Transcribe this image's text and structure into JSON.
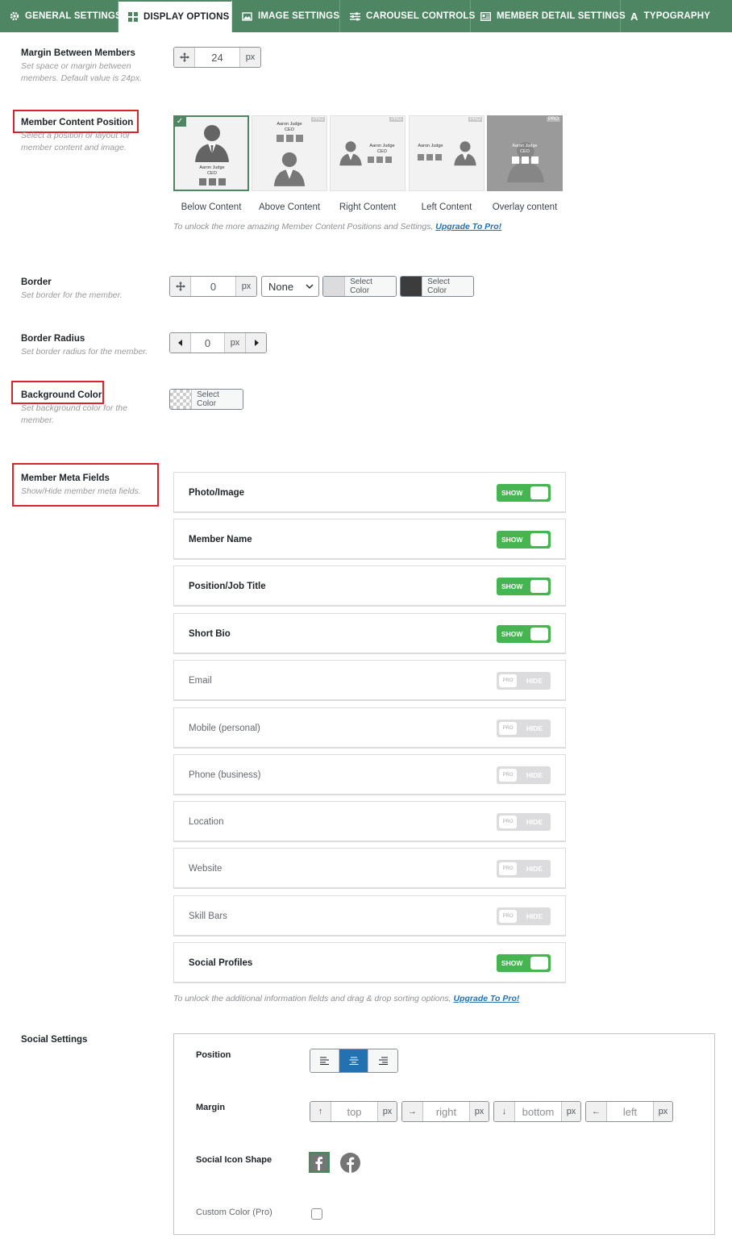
{
  "tabs": [
    {
      "label": "GENERAL SETTINGS",
      "icon": "gear-icon"
    },
    {
      "label": "DISPLAY OPTIONS",
      "icon": "grid-icon",
      "active": true
    },
    {
      "label": "IMAGE SETTINGS",
      "icon": "image-icon"
    },
    {
      "label": "CAROUSEL CONTROLS",
      "icon": "sliders-icon"
    },
    {
      "label": "MEMBER DETAIL SETTINGS",
      "icon": "id-card-icon"
    },
    {
      "label": "TYPOGRAPHY",
      "icon": "font-icon"
    }
  ],
  "margin": {
    "title": "Margin Between Members",
    "desc": "Set space or margin between members. Default value is 24px.",
    "value": "24",
    "unit": "px"
  },
  "content_position": {
    "title": "Member Content Position",
    "desc": "Select a position or layout for member content and image.",
    "sample_name": "Aaron Judge",
    "sample_role": "CEO",
    "pro_badge": "PRO",
    "options": [
      "Below Content",
      "Above Content",
      "Right Content",
      "Left Content",
      "Overlay content"
    ],
    "note": "To unlock the more amazing Member Content Positions and Settings, ",
    "note_link": "Upgrade To Pro!"
  },
  "border": {
    "title": "Border",
    "desc": "Set border for the member.",
    "value": "0",
    "unit": "px",
    "style": "None",
    "color_label": "Select Color",
    "hover_color_label": "Select Color",
    "swatch1": "#dcdcde",
    "swatch2": "#3c3c3c"
  },
  "border_radius": {
    "title": "Border Radius",
    "desc": "Set border radius for the member.",
    "value": "0",
    "unit": "px"
  },
  "background": {
    "title": "Background Color",
    "desc": "Set background color for the member.",
    "color_label": "Select Color"
  },
  "meta_fields": {
    "title": "Member Meta Fields",
    "desc": "Show/Hide member meta fields.",
    "show_label": "SHOW",
    "hide_label": "HIDE",
    "pro_label": "PRO",
    "items": [
      {
        "label": "Photo/Image",
        "on": true
      },
      {
        "label": "Member Name",
        "on": true
      },
      {
        "label": "Position/Job Title",
        "on": true
      },
      {
        "label": "Short Bio",
        "on": true
      },
      {
        "label": "Email",
        "on": false
      },
      {
        "label": "Mobile (personal)",
        "on": false
      },
      {
        "label": "Phone (business)",
        "on": false
      },
      {
        "label": "Location",
        "on": false
      },
      {
        "label": "Website",
        "on": false
      },
      {
        "label": "Skill Bars",
        "on": false
      },
      {
        "label": "Social Profiles",
        "on": true
      }
    ],
    "note": "To unlock the additional information fields and drag & drop sorting options, ",
    "note_link": "Upgrade To Pro!"
  },
  "social": {
    "title": "Social Settings",
    "position_label": "Position",
    "margin_label": "Margin",
    "margin_fields": [
      {
        "placeholder": "top",
        "icon": "arrow-up-icon"
      },
      {
        "placeholder": "right",
        "icon": "arrow-right-icon"
      },
      {
        "placeholder": "bottom",
        "icon": "arrow-down-icon"
      },
      {
        "placeholder": "left",
        "icon": "arrow-left-icon"
      }
    ],
    "unit": "px",
    "shape_label": "Social Icon Shape",
    "custom_color_label": "Custom Color (Pro)"
  },
  "colors": {
    "accent": "#4e8563",
    "toggle_on": "#46b450",
    "active_button": "#2271b1",
    "highlight": "#d9232d"
  }
}
